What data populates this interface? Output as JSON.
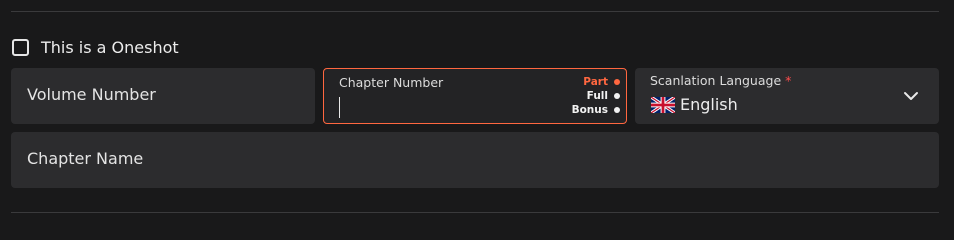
{
  "oneshot": {
    "label": "This is a Oneshot",
    "checked": false
  },
  "volume": {
    "placeholder": "Volume Number"
  },
  "chapter": {
    "label": "Chapter Number",
    "value": "",
    "types": [
      {
        "label": "Part",
        "active": true
      },
      {
        "label": "Full",
        "active": false
      },
      {
        "label": "Bonus",
        "active": false
      }
    ]
  },
  "language": {
    "label": "Scanlation Language",
    "required_mark": "*",
    "value": "English",
    "flag_icon": "uk-flag-icon"
  },
  "chapter_name": {
    "placeholder": "Chapter Name"
  },
  "colors": {
    "accent": "#ff6740",
    "required": "#ff4d4d",
    "background": "#19191a",
    "field": "#2c2c2e"
  }
}
